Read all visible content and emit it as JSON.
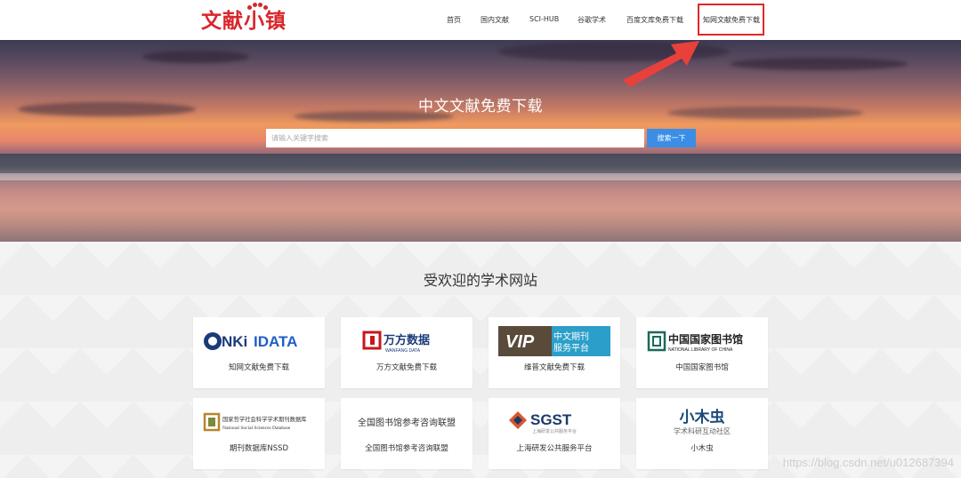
{
  "brand": {
    "logo_text": "文献小镇",
    "color": "#d8262b"
  },
  "nav": {
    "items": [
      {
        "label": "首页"
      },
      {
        "label": "国内文献"
      },
      {
        "label": "SCI-HUB"
      },
      {
        "label": "谷歌学术"
      },
      {
        "label": "百度文库免费下载"
      },
      {
        "label": "知网文献免费下载"
      }
    ]
  },
  "hero": {
    "title": "中文文献免费下载",
    "search_placeholder": "请输入关键字搜索",
    "search_button": "搜索一下"
  },
  "section": {
    "title": "受欢迎的学术网站",
    "cards": [
      {
        "label": "知网文献免费下载",
        "logo": "CNKI IDATA"
      },
      {
        "label": "万方文献免费下载",
        "logo": "万方数据",
        "logo_sub": "WANFANG DATA"
      },
      {
        "label": "维普文献免费下载",
        "logo": "VIP 中文期刊服务平台"
      },
      {
        "label": "中国国家图书馆",
        "logo": "中国国家图书馆",
        "logo_sub": "NATIONAL LIBRARY OF CHINA"
      },
      {
        "label": "期刊数据库NSSD",
        "logo": "国家哲学社会科学学术期刊数据库",
        "logo_sub": "National Social Sciences Database"
      },
      {
        "label": "全国图书馆参考咨询联盟",
        "logo": "全国图书馆参考咨询联盟"
      },
      {
        "label": "上海研发公共服务平台",
        "logo": "SGST",
        "logo_sub": "上海研发公共服务平台"
      },
      {
        "label": "小木虫",
        "logo": "小木虫",
        "logo_sub": "学术科研互动社区"
      }
    ]
  },
  "watermark": "https://blog.csdn.net/u012687394",
  "colors": {
    "accent": "#3a8ee6",
    "highlight": "#e02828"
  }
}
